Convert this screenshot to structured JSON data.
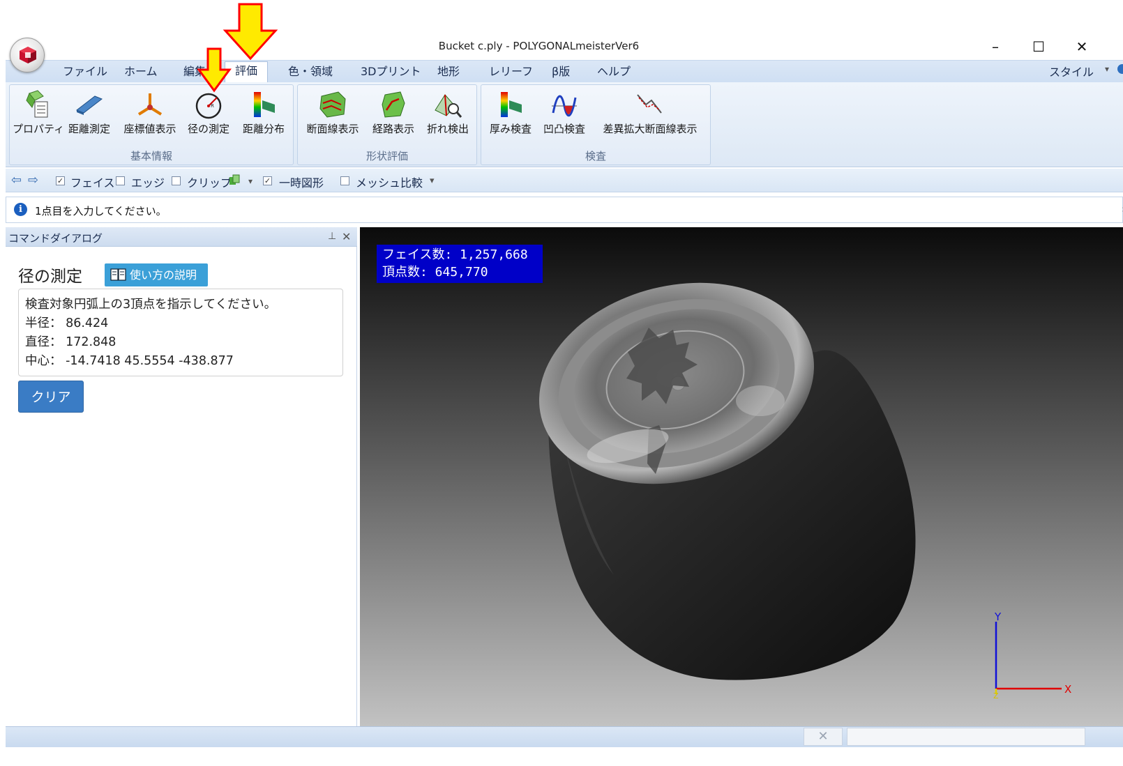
{
  "window": {
    "title": "Bucket c.ply - POLYGONALmeisterVer6",
    "minimize": "–",
    "maximize": "☐",
    "close": "✕"
  },
  "tabs": [
    "ファイル",
    "ホーム",
    "編集",
    "評価",
    "色・領域",
    "3Dプリント",
    "地形",
    "レリーフ",
    "β版",
    "ヘルプ"
  ],
  "active_tab": "評価",
  "style_menu": "スタイル",
  "ribbon": {
    "groups": [
      {
        "label": "基本情報",
        "buttons": [
          "プロパティ",
          "距離測定",
          "座標値表示",
          "径の測定",
          "距離分布"
        ]
      },
      {
        "label": "形状評価",
        "buttons": [
          "断面線表示",
          "経路表示",
          "折れ検出"
        ]
      },
      {
        "label": "検査",
        "buttons": [
          "厚み検査",
          "凹凸検査",
          "差異拡大断面線表示"
        ]
      }
    ]
  },
  "quickbar": {
    "face": "フェイス",
    "edge": "エッジ",
    "clip": "クリップ",
    "temp_shape": "一時図形",
    "mesh_compare": "メッシュ比較",
    "face_checked": true,
    "edge_checked": false,
    "clip_checked": false,
    "temp_shape_checked": true,
    "mesh_compare_checked": false
  },
  "message": "1点目を入力してください。",
  "panel": {
    "title": "コマンドダイアログ",
    "pin": "ᚹ",
    "close": "✕",
    "heading": "径の測定",
    "howto": "使い方の説明",
    "instruction": "検査対象円弧上の3頂点を指示してください。",
    "radius": "半径： 86.424",
    "diameter": "直径： 172.848",
    "center": "中心： -14.7418 45.5554 -438.877",
    "clear": "クリア"
  },
  "viewport": {
    "faces": "フェイス数: 1,257,668",
    "vertices": "頂点数: 645,770",
    "axis_x": "X",
    "axis_y": "Y",
    "axis_z": "Z"
  },
  "status": {
    "x_button": "✕"
  },
  "colors": {
    "arrow_fill": "#ffea00",
    "arrow_stroke": "#ff0000",
    "stats_bg": "#0000c8",
    "howto_bg": "#3ba0d8",
    "clear_bg": "#3a7cc5"
  }
}
